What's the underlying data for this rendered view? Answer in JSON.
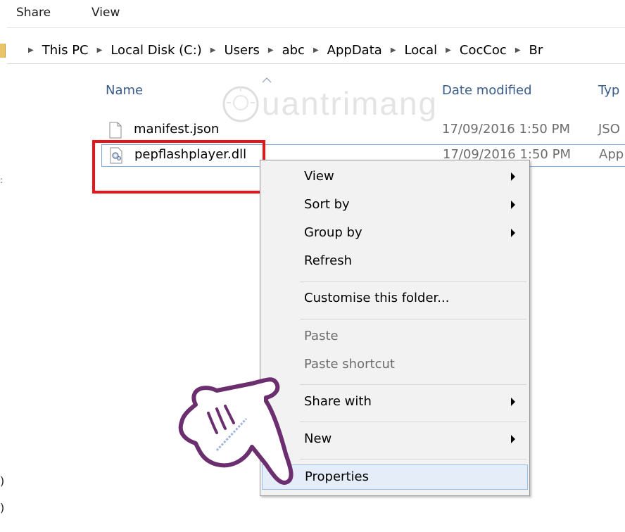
{
  "ribbon": {
    "tabs": [
      "Share",
      "View"
    ]
  },
  "address": {
    "crumbs": [
      "This PC",
      "Local Disk (C:)",
      "Users",
      "abc",
      "AppData",
      "Local",
      "CocCoc",
      "Br"
    ]
  },
  "columns": {
    "name": "Name",
    "date": "Date modified",
    "type": "Typ"
  },
  "files": [
    {
      "name": "manifest.json",
      "date": "17/09/2016 1:50 PM",
      "type": "JSO",
      "icon": "document-icon"
    },
    {
      "name": "pepflashplayer.dll",
      "date": "17/09/2016 1:50 PM",
      "type": "App",
      "icon": "dll-gear-icon"
    }
  ],
  "watermark": {
    "text": "uantrimang"
  },
  "context_menu": {
    "items": [
      {
        "label": "View",
        "submenu": true,
        "enabled": true
      },
      {
        "label": "Sort by",
        "submenu": true,
        "enabled": true
      },
      {
        "label": "Group by",
        "submenu": true,
        "enabled": true
      },
      {
        "label": "Refresh",
        "submenu": false,
        "enabled": true
      },
      {
        "label": "Customise this folder...",
        "submenu": false,
        "enabled": true
      },
      {
        "label": "Paste",
        "submenu": false,
        "enabled": false
      },
      {
        "label": "Paste shortcut",
        "submenu": false,
        "enabled": false
      },
      {
        "label": "Share with",
        "submenu": true,
        "enabled": true
      },
      {
        "label": "New",
        "submenu": true,
        "enabled": true
      },
      {
        "label": "Properties",
        "submenu": false,
        "enabled": true,
        "highlighted": true
      }
    ]
  },
  "colors": {
    "highlight_box": "#e8141c",
    "menu_hover": "#e5eef8",
    "column_header": "#3a5c89",
    "hand": "#6b2f6f"
  }
}
